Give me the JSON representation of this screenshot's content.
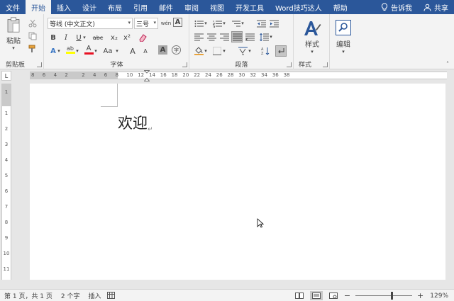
{
  "tabs": [
    {
      "label": "文件",
      "active": false
    },
    {
      "label": "开始",
      "active": true
    },
    {
      "label": "插入",
      "active": false
    },
    {
      "label": "设计",
      "active": false
    },
    {
      "label": "布局",
      "active": false
    },
    {
      "label": "引用",
      "active": false
    },
    {
      "label": "邮件",
      "active": false
    },
    {
      "label": "审阅",
      "active": false
    },
    {
      "label": "视图",
      "active": false
    },
    {
      "label": "开发工具",
      "active": false
    },
    {
      "label": "Word技巧达人",
      "active": false
    },
    {
      "label": "帮助",
      "active": false
    }
  ],
  "tell_me": "告诉我",
  "share": "共享",
  "ribbon": {
    "clipboard": {
      "label": "剪贴板",
      "paste": "粘贴"
    },
    "font": {
      "label": "字体",
      "font_name": "等线 (中文正文)",
      "font_size": "三号",
      "bold": "B",
      "italic": "I",
      "underline": "U",
      "strike": "abc",
      "subscript": "x₂",
      "superscript": "x²",
      "text_effect": "A",
      "highlight": "ab",
      "font_color": "A",
      "case": "Aa",
      "grow": "A",
      "shrink": "A",
      "wen": "wén",
      "border_char": "A",
      "shade_char": "A",
      "enclose": "字"
    },
    "paragraph": {
      "label": "段落"
    },
    "styles": {
      "label": "样式",
      "button": "样式"
    },
    "editing": {
      "label": "编辑",
      "button": "编辑"
    }
  },
  "ruler": {
    "h_labels": [
      "8",
      "6",
      "4",
      "2",
      "2",
      "4",
      "6",
      "8",
      "10",
      "12",
      "14",
      "16",
      "18",
      "20",
      "22",
      "24",
      "26",
      "28",
      "30",
      "32",
      "34",
      "36",
      "38"
    ],
    "v_labels": [
      "1",
      "1",
      "2",
      "3",
      "4",
      "5",
      "6",
      "7",
      "8",
      "9",
      "10",
      "11"
    ]
  },
  "document": {
    "text": "欢迎",
    "para_mark": "↵"
  },
  "status": {
    "page": "第 1 页，共 1 页",
    "words": "2 个字",
    "mode": "插入",
    "zoom_minus": "−",
    "zoom_plus": "+",
    "zoom": "129%"
  },
  "colors": {
    "accent": "#2b579a",
    "highlight": "#ffff00",
    "font_red": "#e81123"
  }
}
